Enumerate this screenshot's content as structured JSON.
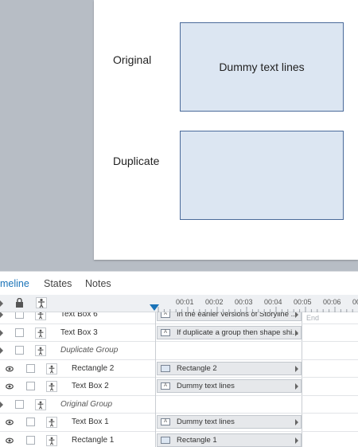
{
  "slide": {
    "label_original": "Original",
    "label_duplicate": "Duplicate",
    "shape_original_text": "Dummy text lines",
    "shape_duplicate_text": ""
  },
  "tabs": [
    {
      "label": "meline",
      "active": true
    },
    {
      "label": "States",
      "active": false
    },
    {
      "label": "Notes",
      "active": false
    }
  ],
  "ruler": {
    "ticks": [
      "00:01",
      "00:02",
      "00:03",
      "00:04",
      "00:05",
      "00:06",
      "00"
    ],
    "end_label": "End"
  },
  "rows": [
    {
      "name": "Text Box 6",
      "group": false,
      "indent": false,
      "bar": "In the earlier versions of Storyline ...",
      "bar_icon": "text-box-icon"
    },
    {
      "name": "Text Box 3",
      "group": false,
      "indent": false,
      "bar": "If duplicate a group then shape shi...",
      "bar_icon": "text-box-icon"
    },
    {
      "name": "Duplicate Group",
      "group": true,
      "indent": false,
      "bar": "",
      "bar_icon": ""
    },
    {
      "name": "Rectangle 2",
      "group": false,
      "indent": true,
      "bar": "Rectangle 2",
      "bar_icon": "rectangle-icon"
    },
    {
      "name": "Text Box 2",
      "group": false,
      "indent": true,
      "bar": "Dummy text lines",
      "bar_icon": "text-box-icon"
    },
    {
      "name": "Original Group",
      "group": true,
      "indent": false,
      "bar": "",
      "bar_icon": ""
    },
    {
      "name": "Text Box 1",
      "group": false,
      "indent": true,
      "bar": "Dummy text lines",
      "bar_icon": "text-box-icon"
    },
    {
      "name": "Rectangle 1",
      "group": false,
      "indent": true,
      "bar": "Rectangle 1",
      "bar_icon": "rectangle-icon"
    }
  ]
}
